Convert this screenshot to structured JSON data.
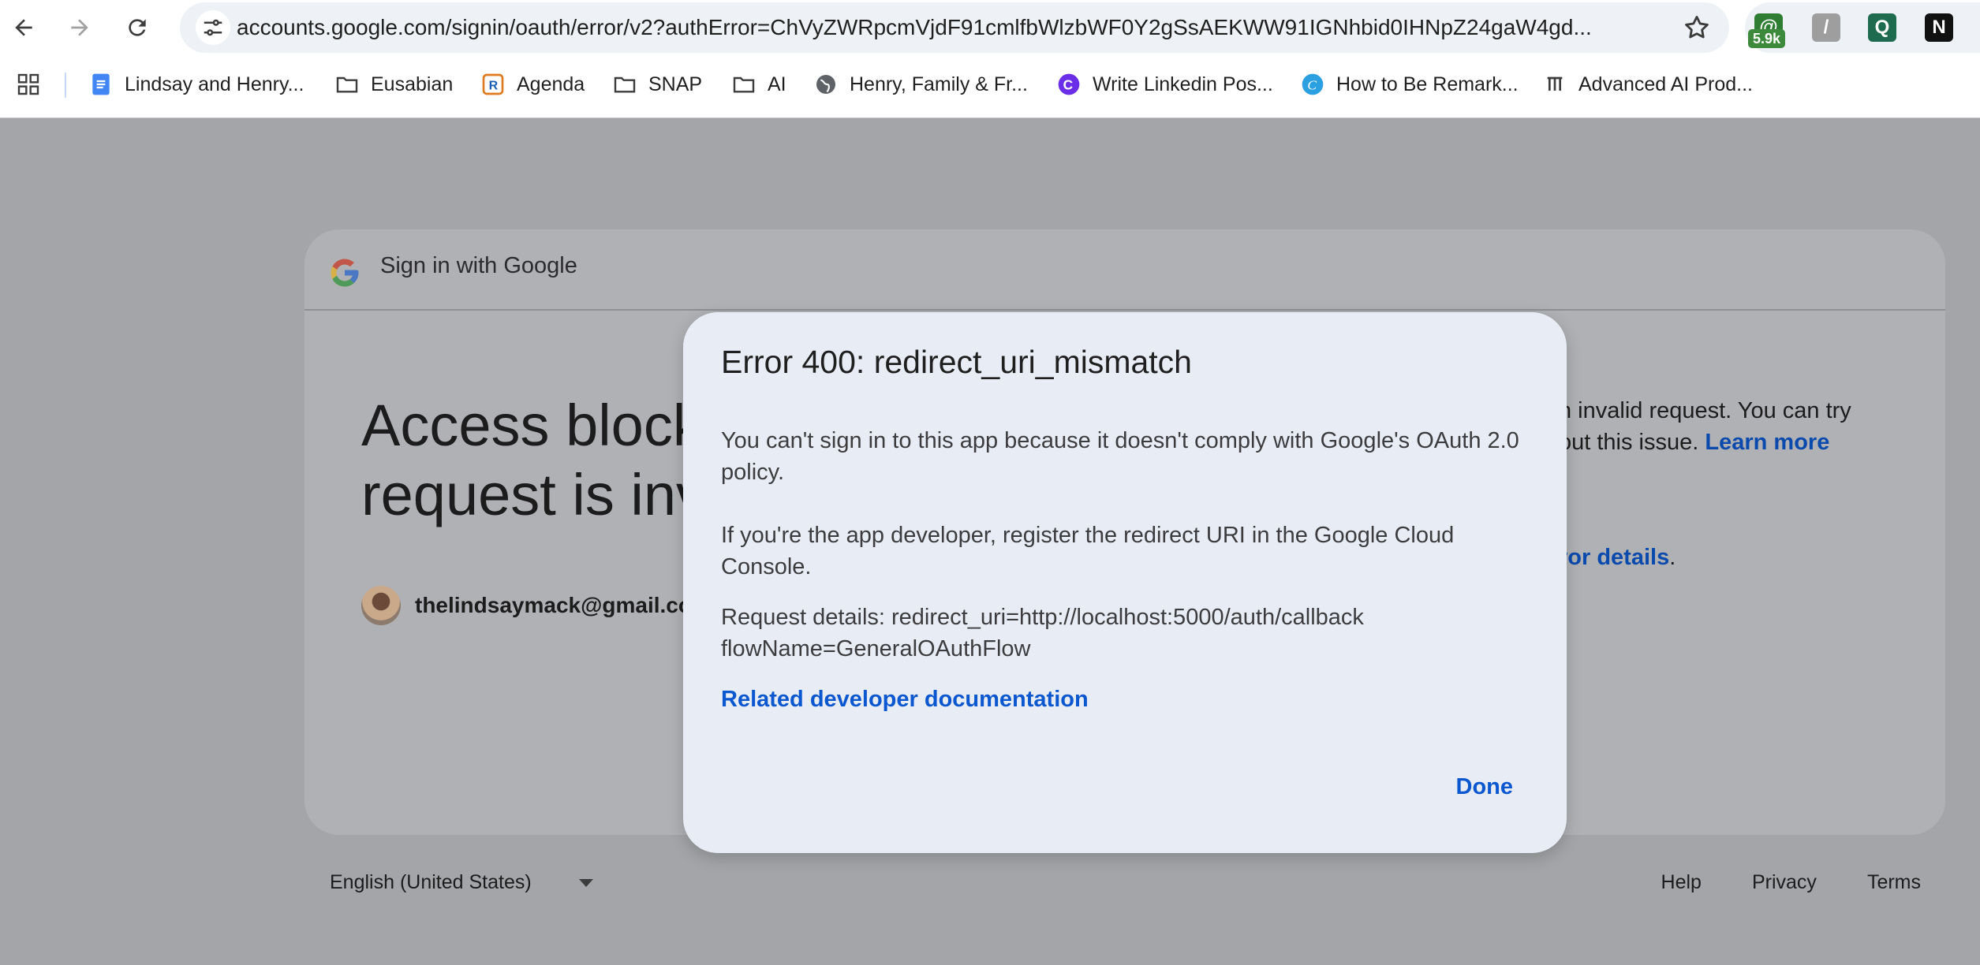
{
  "browser": {
    "url": "accounts.google.com/signin/oauth/error/v2?authError=ChVyZWRpcmVjdF91cmlfbWlzbWF0Y2gSsAEKWW91IGNhbid0IHNpZ24gaW4gd...",
    "extensions": [
      {
        "name": "extension-1",
        "badge": "5.9k",
        "color": "#2f7d32"
      },
      {
        "name": "extension-2",
        "color": "#9e9e9e"
      },
      {
        "name": "extension-3",
        "color": "#1f6b4f"
      },
      {
        "name": "notion",
        "label": "N",
        "color": "#111111"
      }
    ]
  },
  "bookmarks": [
    {
      "label": "Lindsay and Henry...",
      "icon": "docs-icon"
    },
    {
      "label": "Eusabian",
      "icon": "folder-icon"
    },
    {
      "label": "Agenda",
      "icon": "r-icon"
    },
    {
      "label": "SNAP",
      "icon": "folder-icon"
    },
    {
      "label": "AI",
      "icon": "folder-icon"
    },
    {
      "label": "Henry, Family & Fr...",
      "icon": "globe-icon"
    },
    {
      "label": "Write Linkedin Pos...",
      "icon": "c-icon"
    },
    {
      "label": "How to Be Remark...",
      "icon": "canva-icon"
    },
    {
      "label": "Advanced AI Prod...",
      "icon": "bars-icon"
    }
  ],
  "card": {
    "header_title": "Sign in with Google",
    "title_line1": "Access block",
    "title_line2": "request is inv",
    "email": "thelindsaymack@gmail.co",
    "right_text_part1": "n invalid request. You can try",
    "right_text_part2": "out this issue. ",
    "learn_more": "Learn more",
    "error_details": "ror details",
    "error_details_suffix": "."
  },
  "dialog": {
    "title": "Error 400: redirect_uri_mismatch",
    "para1": "You can't sign in to this app because it doesn't comply with Google's OAuth 2.0 policy.",
    "para2": "If you're the app developer, register the redirect URI in the Google Cloud Console.",
    "request_line1": "Request details: redirect_uri=http://localhost:5000/auth/callback",
    "request_line2": "flowName=GeneralOAuthFlow",
    "doc_link": "Related developer documentation",
    "done_label": "Done"
  },
  "footer": {
    "language": "English (United States)",
    "help": "Help",
    "privacy": "Privacy",
    "terms": "Terms"
  }
}
